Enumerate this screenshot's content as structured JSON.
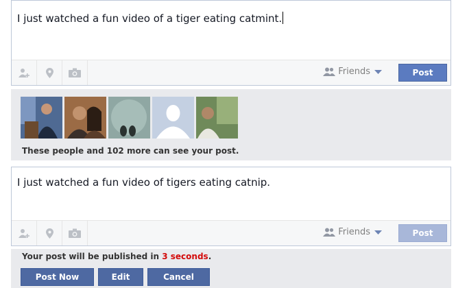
{
  "composer1": {
    "text": "I just watched a fun video of a tiger eating catmint.",
    "audience": "Friends",
    "post_label": "Post"
  },
  "visibility": {
    "caption": "These people and 102 more can see your post."
  },
  "composer2": {
    "text": "I just watched a fun video of tigers eating catnip.",
    "audience": "Friends",
    "post_label": "Post"
  },
  "publish": {
    "message_prefix": "Your post will be published in ",
    "seconds": "3 seconds",
    "message_suffix": ".",
    "buttons": {
      "post_now": "Post Now",
      "edit": "Edit",
      "cancel": "Cancel"
    }
  },
  "icons": [
    "tag-friends-icon",
    "location-pin-icon",
    "camera-icon",
    "friends-audience-icon",
    "dropdown-caret-icon"
  ],
  "colors": {
    "primary_button": "#5b7bc0",
    "disabled_button": "#a8b7d9",
    "action_button": "#4e69a2",
    "countdown": "#d30b0b",
    "panel_bg": "#e9eaed"
  }
}
